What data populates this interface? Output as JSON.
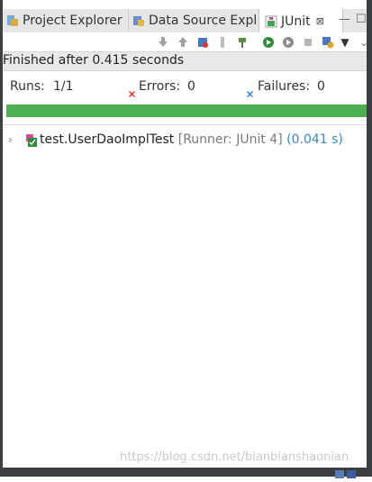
{
  "tabs": {
    "project_explorer": "Project Explorer",
    "data_source": "Data Source Expl",
    "junit": "JUnit",
    "close_glyph": "⊠"
  },
  "window_controls": {
    "minimize": "—",
    "maximize": "☐"
  },
  "status": {
    "finished_text": "Finished after 0.415 seconds"
  },
  "counts": {
    "runs_label": "Runs:",
    "runs_value": "1/1",
    "errors_label": "Errors:",
    "errors_value": "0",
    "failures_label": "Failures:",
    "failures_value": "0"
  },
  "progress": {
    "fraction": 1.0,
    "color": "#4caf50"
  },
  "tree": [
    {
      "name": "test.UserDaoImplTest",
      "runner": "[Runner: JUnit 4]",
      "time": "(0.041 s)"
    }
  ],
  "watermark": "https://blog.csdn.net/bianbianshaonian",
  "icons": {
    "toolbar": [
      "next-failure-icon",
      "previous-failure-icon",
      "failures-only-icon",
      "scroll-lock-icon",
      "pin-icon",
      "rerun-icon",
      "rerun-failed-first-icon",
      "stop-icon",
      "history-icon",
      "dropdown-icon",
      "view-menu-icon"
    ]
  }
}
